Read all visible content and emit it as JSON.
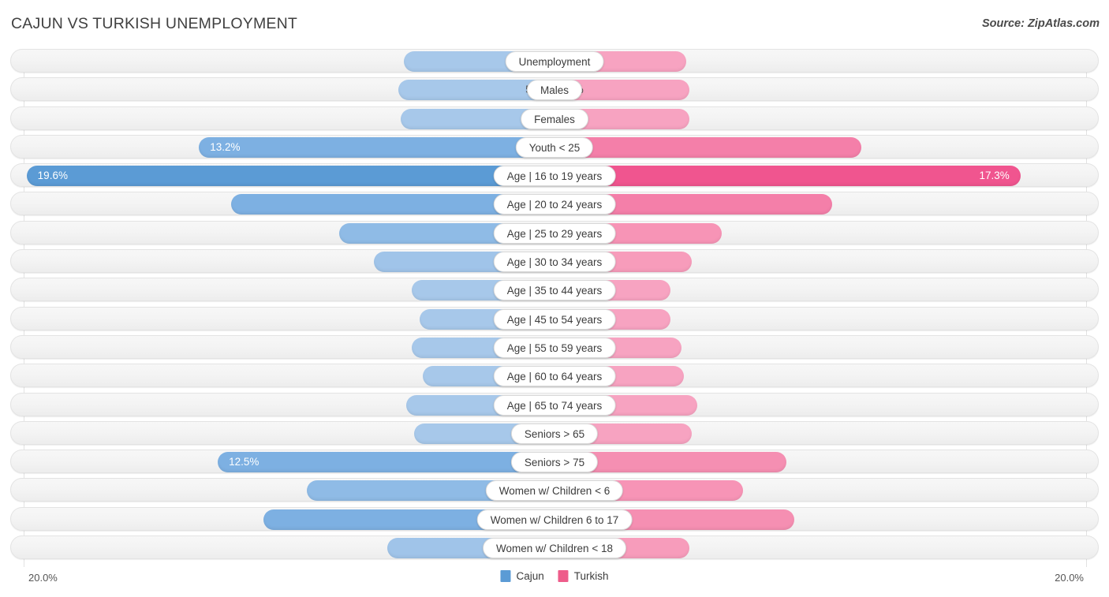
{
  "header": {
    "title": "CAJUN VS TURKISH UNEMPLOYMENT",
    "source": "Source: ZipAtlas.com"
  },
  "legend": {
    "items": [
      {
        "label": "Cajun",
        "color": "#5B9BD5"
      },
      {
        "label": "Turkish",
        "color": "#EE5C8A"
      }
    ]
  },
  "axis": {
    "left_label": "20.0%",
    "right_label": "20.0%",
    "max": 20.0
  },
  "colors": {
    "cajun_light": "#A7C8EA",
    "cajun_mid": "#7DB0E2",
    "cajun_dark": "#5B9BD5",
    "turkish_light": "#F7A3C1",
    "turkish_mid": "#F47FA9",
    "turkish_dark": "#F0558F",
    "row_track": "#F4F4F4",
    "gridline": "#E2E2E2"
  },
  "chart_data": {
    "type": "bar",
    "title": "CAJUN VS TURKISH UNEMPLOYMENT",
    "subtitle": "Source: ZipAtlas.com",
    "orientation": "horizontal-diverging",
    "xlabel": "",
    "ylabel": "",
    "xlim": [
      0,
      20.0
    ],
    "unit": "%",
    "grid": true,
    "legend_position": "bottom-center",
    "series": [
      {
        "name": "Cajun",
        "color": "#5B9BD5",
        "side": "left",
        "values": [
          5.6,
          5.8,
          5.7,
          13.2,
          19.6,
          12.0,
          8.0,
          6.7,
          5.3,
          5.0,
          5.3,
          4.9,
          5.5,
          5.2,
          12.5,
          9.2,
          10.8,
          6.2
        ]
      },
      {
        "name": "Turkish",
        "color": "#EE5C8A",
        "side": "right",
        "values": [
          4.9,
          5.0,
          5.0,
          11.4,
          17.3,
          10.3,
          6.2,
          5.1,
          4.3,
          4.3,
          4.7,
          4.8,
          5.3,
          5.1,
          8.6,
          7.0,
          8.9,
          5.0
        ]
      }
    ],
    "categories": [
      "Unemployment",
      "Males",
      "Females",
      "Youth < 25",
      "Age | 16 to 19 years",
      "Age | 20 to 24 years",
      "Age | 25 to 29 years",
      "Age | 30 to 34 years",
      "Age | 35 to 44 years",
      "Age | 45 to 54 years",
      "Age | 55 to 59 years",
      "Age | 60 to 64 years",
      "Age | 65 to 74 years",
      "Seniors > 65",
      "Seniors > 75",
      "Women w/ Children < 6",
      "Women w/ Children 6 to 17",
      "Women w/ Children < 18"
    ]
  },
  "rows": [
    {
      "label": "Unemployment",
      "left_value": "5.6%",
      "right_value": "4.9%",
      "left_num": 5.6,
      "right_num": 4.9,
      "left_inside": false,
      "right_inside": false,
      "left_color": "#A7C8EA",
      "right_color": "#F7A3C1"
    },
    {
      "label": "Males",
      "left_value": "5.8%",
      "right_value": "5.0%",
      "left_num": 5.8,
      "right_num": 5.0,
      "left_inside": false,
      "right_inside": false,
      "left_color": "#A7C8EA",
      "right_color": "#F7A3C1"
    },
    {
      "label": "Females",
      "left_value": "5.7%",
      "right_value": "5.0%",
      "left_num": 5.7,
      "right_num": 5.0,
      "left_inside": false,
      "right_inside": false,
      "left_color": "#A7C8EA",
      "right_color": "#F7A3C1"
    },
    {
      "label": "Youth < 25",
      "left_value": "13.2%",
      "right_value": "11.4%",
      "left_num": 13.2,
      "right_num": 11.4,
      "left_inside": true,
      "right_inside": false,
      "left_color": "#7DB0E2",
      "right_color": "#F47FA9"
    },
    {
      "label": "Age | 16 to 19 years",
      "left_value": "19.6%",
      "right_value": "17.3%",
      "left_num": 19.6,
      "right_num": 17.3,
      "left_inside": true,
      "right_inside": true,
      "left_color": "#5B9BD5",
      "right_color": "#F0558F"
    },
    {
      "label": "Age | 20 to 24 years",
      "left_value": "12.0%",
      "right_value": "10.3%",
      "left_num": 12.0,
      "right_num": 10.3,
      "left_inside": false,
      "right_inside": false,
      "left_color": "#7DB0E2",
      "right_color": "#F47FA9"
    },
    {
      "label": "Age | 25 to 29 years",
      "left_value": "8.0%",
      "right_value": "6.2%",
      "left_num": 8.0,
      "right_num": 6.2,
      "left_inside": false,
      "right_inside": false,
      "left_color": "#8FBBE6",
      "right_color": "#F794B6"
    },
    {
      "label": "Age | 30 to 34 years",
      "left_value": "6.7%",
      "right_value": "5.1%",
      "left_num": 6.7,
      "right_num": 5.1,
      "left_inside": false,
      "right_inside": false,
      "left_color": "#A0C4E9",
      "right_color": "#F79CBB"
    },
    {
      "label": "Age | 35 to 44 years",
      "left_value": "5.3%",
      "right_value": "4.3%",
      "left_num": 5.3,
      "right_num": 4.3,
      "left_inside": false,
      "right_inside": false,
      "left_color": "#A7C8EA",
      "right_color": "#F7A3C1"
    },
    {
      "label": "Age | 45 to 54 years",
      "left_value": "5.0%",
      "right_value": "4.3%",
      "left_num": 5.0,
      "right_num": 4.3,
      "left_inside": false,
      "right_inside": false,
      "left_color": "#A7C8EA",
      "right_color": "#F7A3C1"
    },
    {
      "label": "Age | 55 to 59 years",
      "left_value": "5.3%",
      "right_value": "4.7%",
      "left_num": 5.3,
      "right_num": 4.7,
      "left_inside": false,
      "right_inside": false,
      "left_color": "#A7C8EA",
      "right_color": "#F7A3C1"
    },
    {
      "label": "Age | 60 to 64 years",
      "left_value": "4.9%",
      "right_value": "4.8%",
      "left_num": 4.9,
      "right_num": 4.8,
      "left_inside": false,
      "right_inside": false,
      "left_color": "#A7C8EA",
      "right_color": "#F7A3C1"
    },
    {
      "label": "Age | 65 to 74 years",
      "left_value": "5.5%",
      "right_value": "5.3%",
      "left_num": 5.5,
      "right_num": 5.3,
      "left_inside": false,
      "right_inside": false,
      "left_color": "#A7C8EA",
      "right_color": "#F7A3C1"
    },
    {
      "label": "Seniors > 65",
      "left_value": "5.2%",
      "right_value": "5.1%",
      "left_num": 5.2,
      "right_num": 5.1,
      "left_inside": false,
      "right_inside": false,
      "left_color": "#A7C8EA",
      "right_color": "#F7A3C1"
    },
    {
      "label": "Seniors > 75",
      "left_value": "12.5%",
      "right_value": "8.6%",
      "left_num": 12.5,
      "right_num": 8.6,
      "left_inside": true,
      "right_inside": false,
      "left_color": "#7DB0E2",
      "right_color": "#F58FB2"
    },
    {
      "label": "Women w/ Children < 6",
      "left_value": "9.2%",
      "right_value": "7.0%",
      "left_num": 9.2,
      "right_num": 7.0,
      "left_inside": false,
      "right_inside": false,
      "left_color": "#8FBBE6",
      "right_color": "#F794B6"
    },
    {
      "label": "Women w/ Children 6 to 17",
      "left_value": "10.8%",
      "right_value": "8.9%",
      "left_num": 10.8,
      "right_num": 8.9,
      "left_inside": false,
      "right_inside": false,
      "left_color": "#7DB0E2",
      "right_color": "#F58FB2"
    },
    {
      "label": "Women w/ Children < 18",
      "left_value": "6.2%",
      "right_value": "5.0%",
      "left_num": 6.2,
      "right_num": 5.0,
      "left_inside": false,
      "right_inside": false,
      "left_color": "#A0C4E9",
      "right_color": "#F79CBB"
    }
  ]
}
